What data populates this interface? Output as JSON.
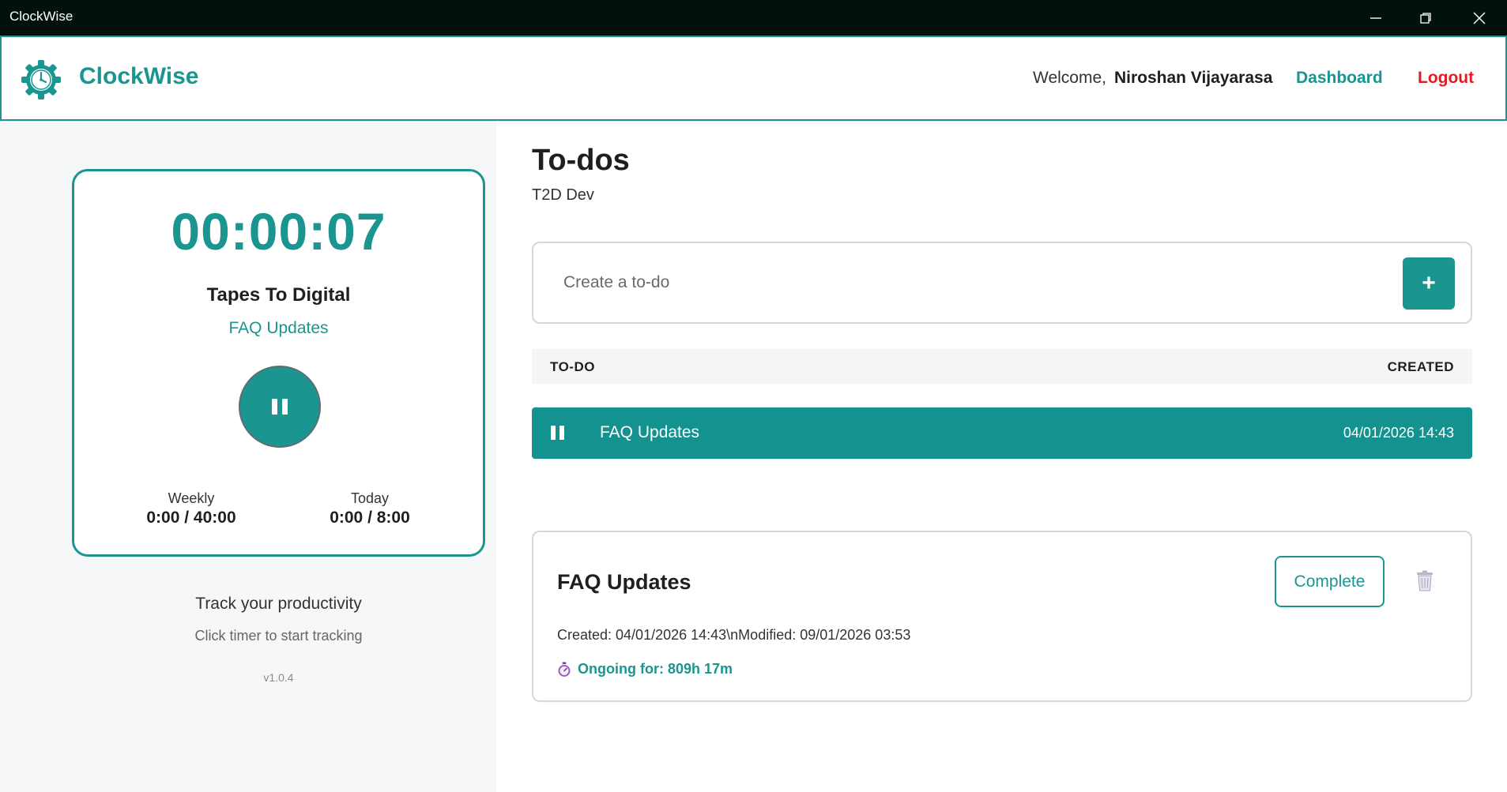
{
  "window": {
    "title": "ClockWise"
  },
  "header": {
    "brand": "ClockWise",
    "welcome_label": "Welcome,",
    "username": "Niroshan Vijayarasa",
    "nav_dashboard": "Dashboard",
    "nav_logout": "Logout"
  },
  "timer": {
    "elapsed": "00:00:07",
    "project": "Tapes To Digital",
    "task": "FAQ Updates",
    "weekly_label": "Weekly",
    "weekly_value": "0:00 / 40:00",
    "today_label": "Today",
    "today_value": "0:00 / 8:00"
  },
  "left_footer": {
    "tagline": "Track your productivity",
    "hint": "Click timer to start tracking",
    "version": "v1.0.4"
  },
  "main": {
    "title": "To-dos",
    "subtitle": "T2D Dev",
    "create_placeholder": "Create a to-do",
    "add_label": "+",
    "table": {
      "col_todo": "TO-DO",
      "col_created": "CREATED",
      "rows": [
        {
          "name": "FAQ Updates",
          "created": "04/01/2026 14:43"
        }
      ]
    },
    "detail": {
      "title": "FAQ Updates",
      "complete_label": "Complete",
      "meta": "Created: 04/01/2026 14:43\\nModified: 09/01/2026 03:53",
      "ongoing": "Ongoing for: 809h 17m"
    }
  },
  "colors": {
    "accent": "#1a9590",
    "logout": "#e01b22",
    "titlebar": "#02110a",
    "panel_bg": "#f6f7f9"
  },
  "icons": {
    "logo": "clock-gear-icon",
    "minimize": "minimize-icon",
    "restore": "restore-icon",
    "close": "close-icon",
    "pause": "pause-icon",
    "trash": "trash-icon",
    "stopwatch": "stopwatch-icon"
  }
}
